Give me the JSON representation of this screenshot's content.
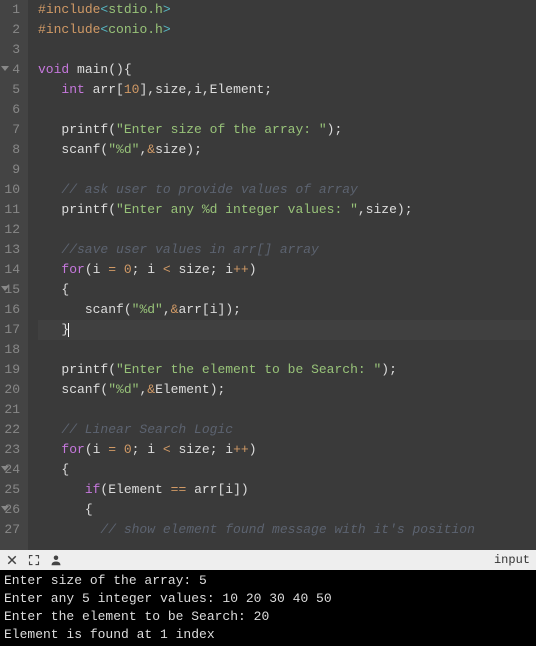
{
  "gutter": {
    "lines": [
      "1",
      "2",
      "3",
      "4",
      "5",
      "6",
      "7",
      "8",
      "9",
      "10",
      "11",
      "12",
      "13",
      "14",
      "15",
      "16",
      "17",
      "18",
      "19",
      "20",
      "21",
      "22",
      "23",
      "24",
      "25",
      "26",
      "27"
    ],
    "fold_lines": [
      4,
      15,
      24,
      26
    ]
  },
  "code": {
    "l1": {
      "hash": "#",
      "include": "include",
      "lt": "<",
      "file": "stdio.h",
      "gt": ">"
    },
    "l2": {
      "hash": "#",
      "include": "include",
      "lt": "<",
      "file": "conio.h",
      "gt": ">"
    },
    "l4": {
      "void": "void",
      "main": " main",
      "open": "()",
      "brace": "{"
    },
    "l5": {
      "indent": "   ",
      "int": "int",
      "rest": " arr",
      "lb": "[",
      "num": "10",
      "rb": "]",
      "rest2": ",size,i,Element;"
    },
    "l7": {
      "indent": "   ",
      "fn": "printf",
      "open": "(",
      "str": "\"Enter size of the array: \"",
      "close": ");"
    },
    "l8": {
      "indent": "   ",
      "fn": "scanf",
      "open": "(",
      "str": "\"%d\"",
      "mid": ",",
      "amp": "&",
      "ident": "size",
      "close": ");"
    },
    "l10": {
      "indent": "   ",
      "text": "// ask user to provide values of array"
    },
    "l11": {
      "indent": "   ",
      "fn": "printf",
      "open": "(",
      "str": "\"Enter any %d integer values: \"",
      "mid": ",size",
      "close": ");"
    },
    "l13": {
      "indent": "   ",
      "text": "//save user values in arr[] array"
    },
    "l14": {
      "indent": "   ",
      "for": "for",
      "open": "(",
      "i": "i ",
      "eq": "=",
      "zero": " 0",
      "semi": "; i ",
      "lt": "<",
      "rest": " size; i",
      "pp": "++",
      "close": ")"
    },
    "l15": {
      "indent": "   ",
      "brace": "{"
    },
    "l16": {
      "indent": "      ",
      "fn": "scanf",
      "open": "(",
      "str": "\"%d\"",
      "mid": ",",
      "amp": "&",
      "ident": "arr",
      "lb": "[",
      "idx": "i",
      "rb": "]",
      "close": ");"
    },
    "l17": {
      "indent": "   ",
      "brace": "}"
    },
    "l19": {
      "indent": "   ",
      "fn": "printf",
      "open": "(",
      "str": "\"Enter the element to be Search: \"",
      "close": ");"
    },
    "l20": {
      "indent": "   ",
      "fn": "scanf",
      "open": "(",
      "str": "\"%d\"",
      "mid": ",",
      "amp": "&",
      "ident": "Element",
      "close": ");"
    },
    "l22": {
      "indent": "   ",
      "text": "// Linear Search Logic"
    },
    "l23": {
      "indent": "   ",
      "for": "for",
      "open": "(",
      "i": "i ",
      "eq": "=",
      "zero": " 0",
      "semi": "; i ",
      "lt": "<",
      "rest": " size; i",
      "pp": "++",
      "close": ")"
    },
    "l24": {
      "indent": "   ",
      "brace": "{"
    },
    "l25": {
      "indent": "      ",
      "if": "if",
      "open": "(",
      "ident": "Element ",
      "eq": "==",
      "rest": " arr",
      "lb": "[",
      "idx": "i",
      "rb": "]",
      "close": ")"
    },
    "l26": {
      "indent": "      ",
      "brace": "{"
    },
    "l27": {
      "indent": "        ",
      "text": "// show element found message with it's position"
    }
  },
  "status": {
    "right_label": "input"
  },
  "terminal": {
    "l1": "Enter size of the array: 5",
    "l2": "Enter any 5 integer values: 10 20 30 40 50",
    "l3": "Enter the element to be Search: 20",
    "l4": "Element is found at 1 index"
  }
}
